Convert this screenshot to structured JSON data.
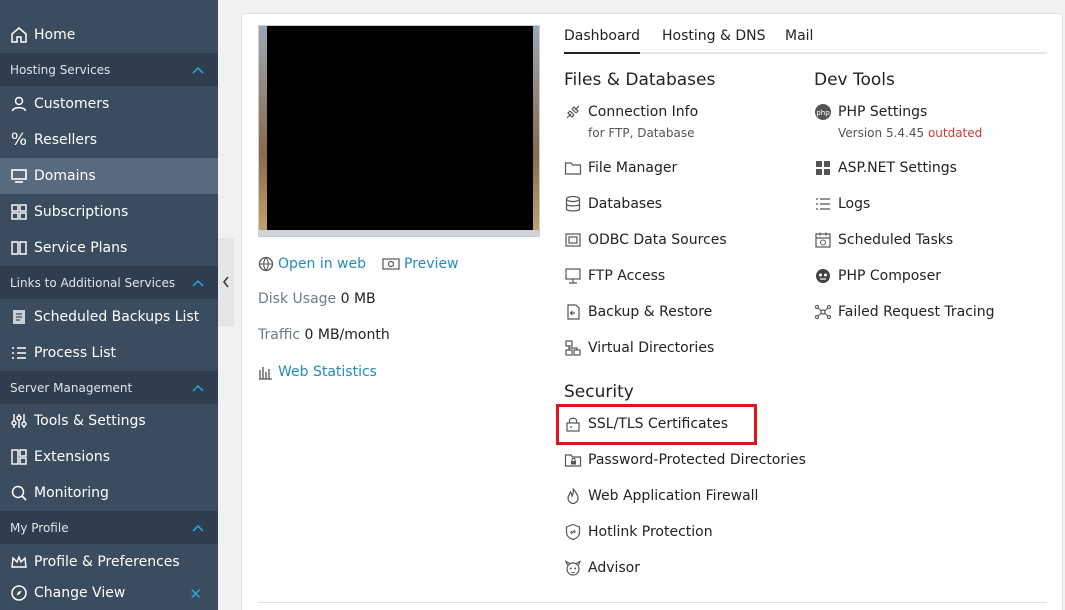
{
  "sidebar": {
    "home": "Home",
    "sections": [
      {
        "label": "Hosting Services"
      },
      {
        "label": "Links to Additional Services"
      },
      {
        "label": "Server Management"
      },
      {
        "label": "My Profile"
      }
    ],
    "items": {
      "customers": "Customers",
      "resellers": "Resellers",
      "domains": "Domains",
      "subscriptions": "Subscriptions",
      "service_plans": "Service Plans",
      "scheduled_backups": "Scheduled Backups List",
      "process_list": "Process List",
      "tools_settings": "Tools & Settings",
      "extensions": "Extensions",
      "monitoring": "Monitoring",
      "profile_prefs": "Profile & Preferences"
    },
    "change_view": "Change View",
    "active_item": "Domains"
  },
  "site": {
    "open_in_web": "Open in web",
    "preview": "Preview",
    "disk_usage_label": "Disk Usage",
    "disk_usage_value": "0 MB",
    "traffic_label": "Traffic",
    "traffic_value": "0 MB/month",
    "web_statistics": "Web Statistics"
  },
  "tabs": [
    "Dashboard",
    "Hosting & DNS",
    "Mail"
  ],
  "active_tab": "Dashboard",
  "files_databases": {
    "title": "Files & Databases",
    "connection_info": "Connection Info",
    "connection_info_sub": "for FTP, Database",
    "file_manager": "File Manager",
    "databases": "Databases",
    "odbc": "ODBC Data Sources",
    "ftp_access": "FTP Access",
    "backup_restore": "Backup & Restore",
    "virtual_dirs": "Virtual Directories"
  },
  "dev_tools": {
    "title": "Dev Tools",
    "php_settings": "PHP Settings",
    "php_version_label": "Version 5.4.45",
    "php_version_status": "outdated",
    "aspnet": "ASP.NET Settings",
    "logs": "Logs",
    "scheduled_tasks": "Scheduled Tasks",
    "php_composer": "PHP Composer",
    "failed_request_tracing": "Failed Request Tracing"
  },
  "security": {
    "title": "Security",
    "ssl_tls": "SSL/TLS Certificates",
    "password_dirs": "Password-Protected Directories",
    "waf": "Web Application Firewall",
    "hotlink": "Hotlink Protection",
    "advisor": "Advisor"
  },
  "colors": {
    "sidebar_bg": "#3b4c5e",
    "sidebar_section_bg": "#2f3e4e",
    "sidebar_active": "#576a7e",
    "link": "#1f8cc4",
    "highlight": "#e0151b",
    "warn": "#d0383b"
  }
}
